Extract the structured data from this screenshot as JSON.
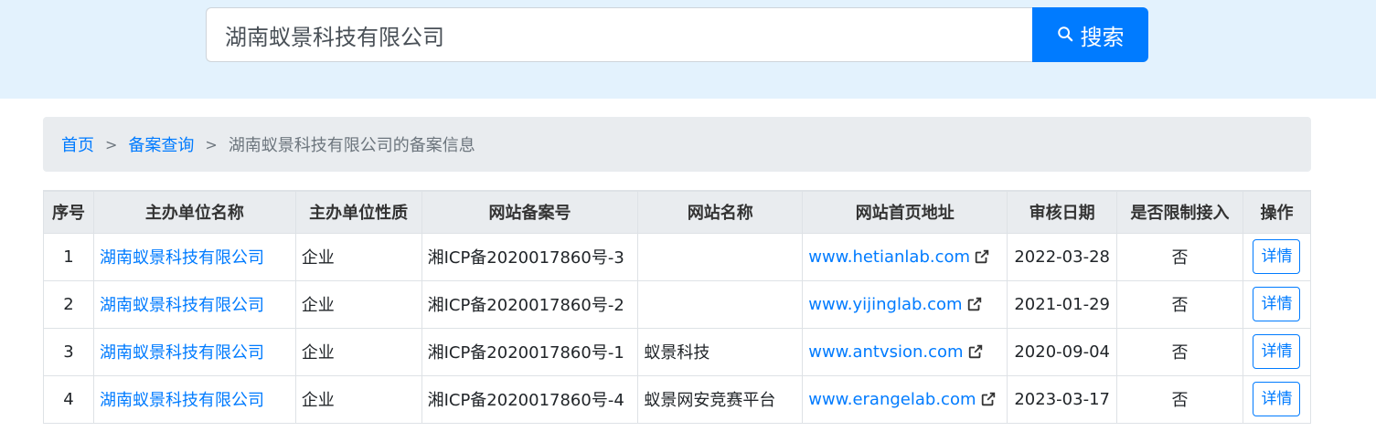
{
  "search": {
    "value": "湖南蚁景科技有限公司",
    "button_label": "搜索"
  },
  "breadcrumb": {
    "home": "首页",
    "sep1": ">",
    "icp_query": "备案查询",
    "sep2": ">",
    "current": "湖南蚁景科技有限公司的备案信息"
  },
  "table": {
    "headers": [
      "序号",
      "主办单位名称",
      "主办单位性质",
      "网站备案号",
      "网站名称",
      "网站首页地址",
      "审核日期",
      "是否限制接入",
      "操作"
    ],
    "rows": [
      {
        "index": "1",
        "org": "湖南蚁景科技有限公司",
        "type": "企业",
        "icp": "湘ICP备2020017860号-3",
        "site_name": "",
        "url": "www.hetianlab.com",
        "date": "2022-03-28",
        "restricted": "否",
        "action": "详情"
      },
      {
        "index": "2",
        "org": "湖南蚁景科技有限公司",
        "type": "企业",
        "icp": "湘ICP备2020017860号-2",
        "site_name": "",
        "url": "www.yijinglab.com",
        "date": "2021-01-29",
        "restricted": "否",
        "action": "详情"
      },
      {
        "index": "3",
        "org": "湖南蚁景科技有限公司",
        "type": "企业",
        "icp": "湘ICP备2020017860号-1",
        "site_name": "蚁景科技",
        "url": "www.antvsion.com",
        "date": "2020-09-04",
        "restricted": "否",
        "action": "详情"
      },
      {
        "index": "4",
        "org": "湖南蚁景科技有限公司",
        "type": "企业",
        "icp": "湘ICP备2020017860号-4",
        "site_name": "蚁景网安竞赛平台",
        "url": "www.erangelab.com",
        "date": "2023-03-17",
        "restricted": "否",
        "action": "详情"
      }
    ]
  },
  "icons": {
    "search": "search-icon",
    "external": "external-link-icon"
  },
  "colors": {
    "accent": "#007bff",
    "band": "#e3f2fd",
    "breadcrumb_bg": "#e9ecef"
  }
}
